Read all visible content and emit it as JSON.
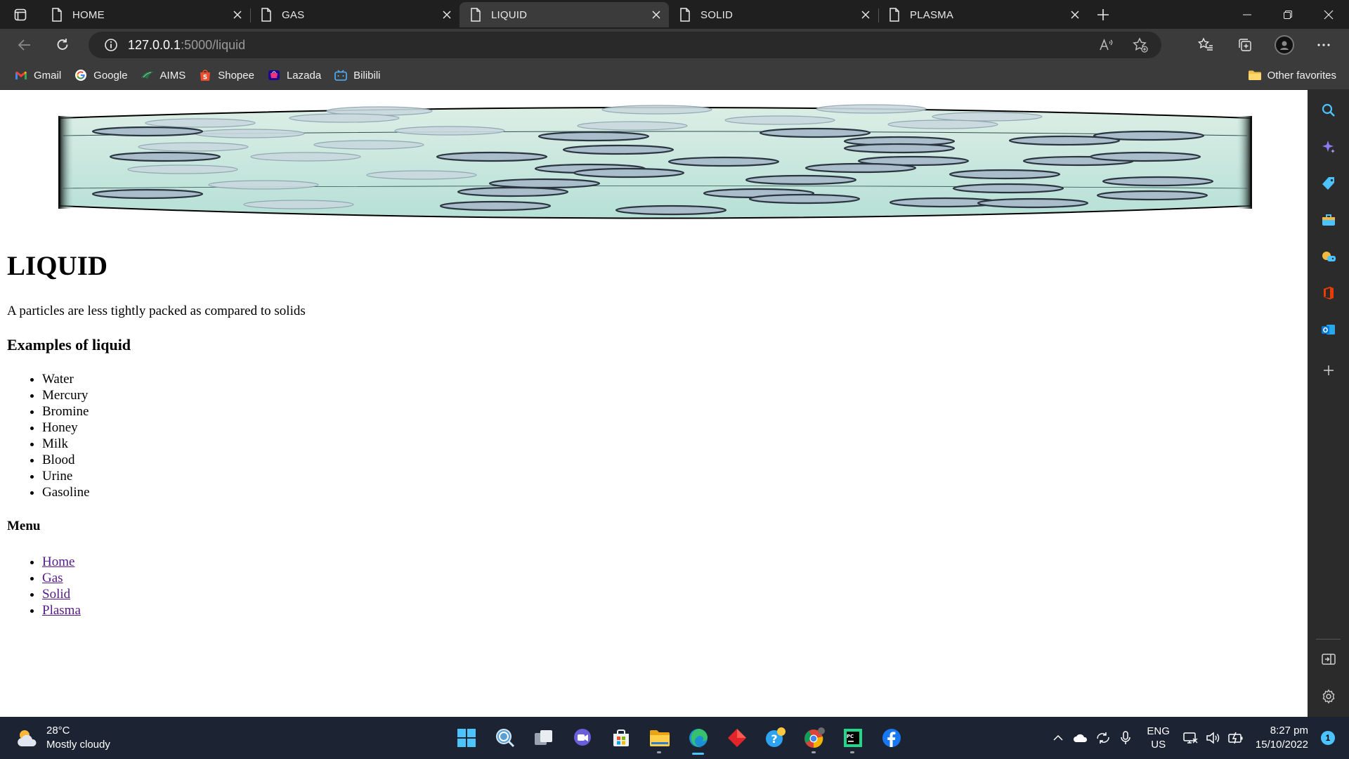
{
  "browser": {
    "tabs": [
      {
        "title": "HOME",
        "active": false
      },
      {
        "title": "GAS",
        "active": false
      },
      {
        "title": "LIQUID",
        "active": true
      },
      {
        "title": "SOLID",
        "active": false
      },
      {
        "title": "PLASMA",
        "active": false
      }
    ],
    "address": {
      "host": "127.0.0.1",
      "path": ":5000/liquid"
    },
    "favorites": [
      {
        "label": "Gmail",
        "icon": "gmail-icon"
      },
      {
        "label": "Google",
        "icon": "google-icon"
      },
      {
        "label": "AIMS",
        "icon": "aims-icon"
      },
      {
        "label": "Shopee",
        "icon": "shopee-icon"
      },
      {
        "label": "Lazada",
        "icon": "lazada-icon"
      },
      {
        "label": "Bilibili",
        "icon": "bilibili-icon"
      }
    ],
    "other_favorites": "Other favorites",
    "accent_color": "#4cc2ff"
  },
  "page": {
    "title": "LIQUID",
    "description": "A particles are less tightly packed as compared to solids",
    "examples_heading": "Examples of liquid",
    "examples": [
      "Water",
      "Mercury",
      "Bromine",
      "Honey",
      "Milk",
      "Blood",
      "Urine",
      "Gasoline"
    ],
    "menu_heading": "Menu",
    "menu": [
      "Home",
      "Gas",
      "Solid",
      "Plasma"
    ],
    "link_color": "#551a8b"
  },
  "taskbar": {
    "weather": {
      "temp": "28°C",
      "condition": "Mostly cloudy"
    },
    "lang": {
      "line1": "ENG",
      "line2": "US"
    },
    "clock": {
      "time": "8:27 pm",
      "date": "15/10/2022"
    },
    "notifications": "1"
  }
}
